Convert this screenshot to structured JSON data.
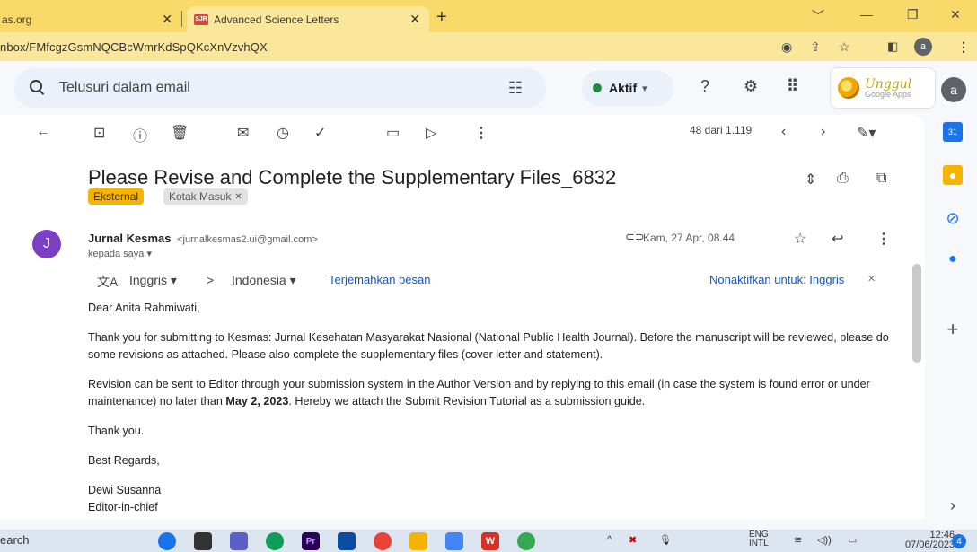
{
  "browser": {
    "tabs": [
      {
        "label": "as.org"
      },
      {
        "label": "Advanced Science Letters",
        "favicon": "SJR"
      }
    ],
    "url": "nbox/FMfcgzGsmNQCBcWmrKdSpQKcXnVzvhQX",
    "profile_initial": "a"
  },
  "gmail": {
    "search_placeholder": "Telusuri dalam email",
    "status_label": "Aktif",
    "brand": {
      "line1": "Unggul",
      "line2": "Google Apps"
    },
    "account_initial": "a"
  },
  "toolbar": {
    "pager": "48 dari 1.119"
  },
  "message": {
    "subject": "Please Revise and Complete the Supplementary Files_6832",
    "labels": [
      "Eksternal",
      "Kotak Masuk"
    ],
    "sender_initial": "J",
    "sender_name": "Jurnal Kesmas",
    "sender_email": "<jurnalkesmas2.ui@gmail.com>",
    "to_line": "kepada saya",
    "date": "Kam, 27 Apr, 08.44",
    "translate": {
      "from": "Inggris",
      "to": "Indonesia",
      "action": "Terjemahkan pesan",
      "disable": "Nonaktifkan untuk: Inggris"
    },
    "body": {
      "greeting": "Dear Anita Rahmiwati,",
      "p1": "Thank you for submitting to Kesmas: Jurnal Kesehatan Masyarakat Nasional (National Public Health Journal). Before the manuscript will be reviewed, please do some revisions as attached. Please also complete the supplementary files (cover letter and statement).",
      "p2_before": "Revision can be sent to Editor through your submission system in the Author Version and by replying to this email (in case the system is found error or under maintenance) no later than ",
      "p2_deadline": "May 2, 2023",
      "p2_after": ". Hereby we attach the Submit Revision Tutorial as a submission guide.",
      "thanks": "Thank you.",
      "regards": "Best Regards,",
      "signer": "Dewi Susanna",
      "signer_title": "Editor-in-chief"
    }
  },
  "taskbar": {
    "search_text": "earch",
    "language": "ENG",
    "language_sub": "INTL",
    "time": "12:46",
    "date": "07/06/2023",
    "notifications": "4"
  },
  "colors": {
    "browser_chrome": "#f8d96a",
    "external_label": "#f4b400",
    "status_green": "#1e8e3e",
    "link_blue": "#0b57d0"
  }
}
